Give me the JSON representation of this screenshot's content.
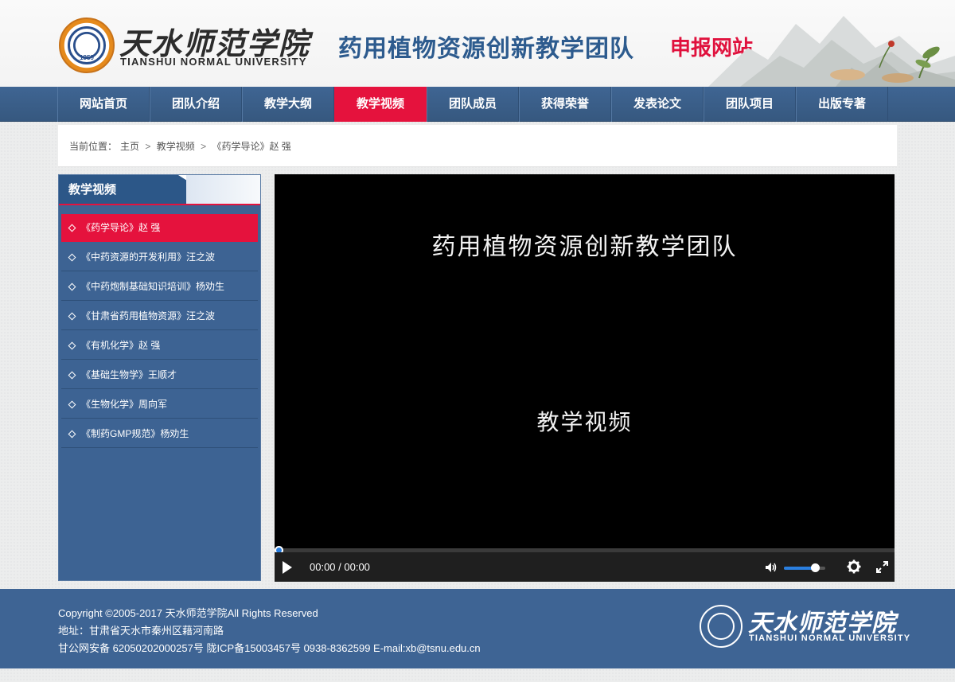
{
  "header": {
    "logo_cn": "天水师范学院",
    "logo_en": "TIANSHUI NORMAL UNIVERSITY",
    "logo_year": "1959",
    "site_title": "药用植物资源创新教学团队",
    "site_sub": "申报网站"
  },
  "nav": {
    "items": [
      "网站首页",
      "团队介绍",
      "教学大纲",
      "教学视频",
      "团队成员",
      "获得荣誉",
      "发表论文",
      "团队项目",
      "出版专著"
    ],
    "active_index": 3
  },
  "breadcrumb": {
    "prefix": "当前位置：",
    "home": "主页",
    "sep": ">",
    "section": "教学视频",
    "current": "《药学导论》赵 强"
  },
  "sidebar": {
    "title": "教学视频",
    "items": [
      "《药学导论》赵 强",
      "《中药资源的开发利用》汪之波",
      "《中药炮制基础知识培训》杨劝生",
      "《甘肃省药用植物资源》汪之波",
      "《有机化学》赵 强",
      "《基础生物学》王顺才",
      "《生物化学》周向军",
      "《制药GMP规范》杨劝生"
    ],
    "active_index": 0
  },
  "video": {
    "frame_title": "药用植物资源创新教学团队",
    "frame_sub": "教学视频",
    "time": "00:00 / 00:00",
    "progress": 0,
    "volume": 0.75
  },
  "footer": {
    "copyright": "Copyright ©2005-2017   天水师范学院All Rights Reserved",
    "address": "地址：甘肃省天水市秦州区藉河南路",
    "record": "甘公网安备 62050202000257号 陇ICP备15003457号    0938-8362599    E-mail:xb@tsnu.edu.cn",
    "logo_cn": "天水师范学院",
    "logo_en": "TIANSHUI NORMAL UNIVERSITY"
  },
  "colors": {
    "nav_bg": "#3e6494",
    "accent_red": "#e5123d",
    "title_blue": "#2d5b8e",
    "video_accent": "#2a7fe0"
  },
  "icons": [
    "play-icon",
    "volume-icon",
    "gear-icon",
    "fullscreen-icon",
    "diamond-bullet-icon"
  ]
}
